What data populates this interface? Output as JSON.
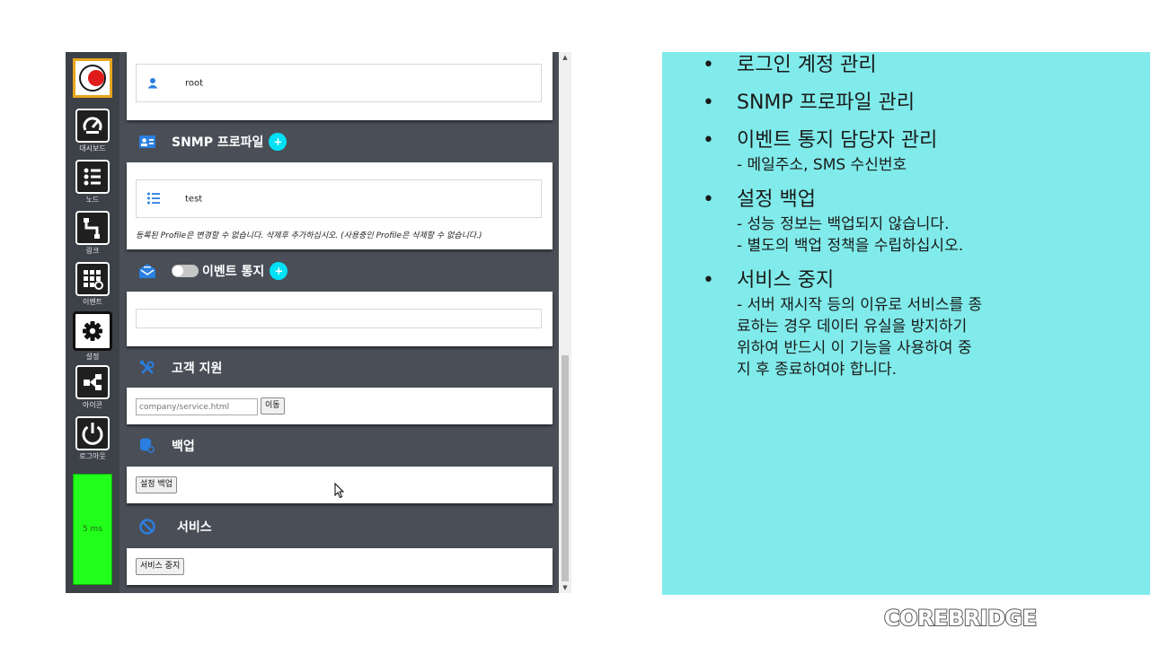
{
  "sidebar": {
    "items": [
      {
        "label": "대시보드",
        "icon": "dashboard-icon"
      },
      {
        "label": "노드",
        "icon": "node-list-icon"
      },
      {
        "label": "링크",
        "icon": "link-icon"
      },
      {
        "label": "이벤트",
        "icon": "event-icon"
      },
      {
        "label": "설정",
        "icon": "gear-icon",
        "active": true
      },
      {
        "label": "아이콘",
        "icon": "icon-share-icon"
      },
      {
        "label": "로그아웃",
        "icon": "power-icon"
      }
    ],
    "status": "5 ms",
    "status_color": "#22ff1a"
  },
  "account": {
    "value": "root"
  },
  "snmp": {
    "title": "SNMP 프로파일",
    "add": "+",
    "profile": "test",
    "note": "등록된 Profile은 변경할 수 없습니다. 삭제후 추가하십시오. (사용중인 Profile은 삭제할 수 없습니다.)"
  },
  "event": {
    "title": "이벤트 통지",
    "add": "+",
    "toggle_on": false
  },
  "support": {
    "title": "고객 지원",
    "placeholder": "company/service.html",
    "go_label": "이동"
  },
  "backup": {
    "title": "백업",
    "button": "설정 백업"
  },
  "service": {
    "title": "서비스",
    "button": "서비스 중지"
  },
  "slide": {
    "bullets": [
      {
        "title": "로그인 계정 관리",
        "sub": []
      },
      {
        "title": "SNMP 프로파일 관리",
        "sub": []
      },
      {
        "title": "이벤트 통지 담당자 관리",
        "sub": [
          "- 메일주소, SMS 수신번호"
        ]
      },
      {
        "title": "설정 백업",
        "sub": [
          "- 성능 정보는 백업되지 않습니다.",
          "- 별도의 백업 정책을 수립하십시오."
        ]
      },
      {
        "title": "서비스 중지",
        "sub": [
          "- 서버 재시작 등의 이유로 서비스를 종",
          "료하는 경우 데이터 유실을 방지하기",
          "위하여 반드시 이 기능을 사용하여 중",
          "지 후 종료하여야 합니다."
        ]
      }
    ],
    "background": "#80ebea",
    "brand": "COREBRIDGE"
  },
  "colors": {
    "accent_cyan": "#00e1f5",
    "icon_blue": "#2a7fe0",
    "dark_bg": "#4a4e57"
  }
}
